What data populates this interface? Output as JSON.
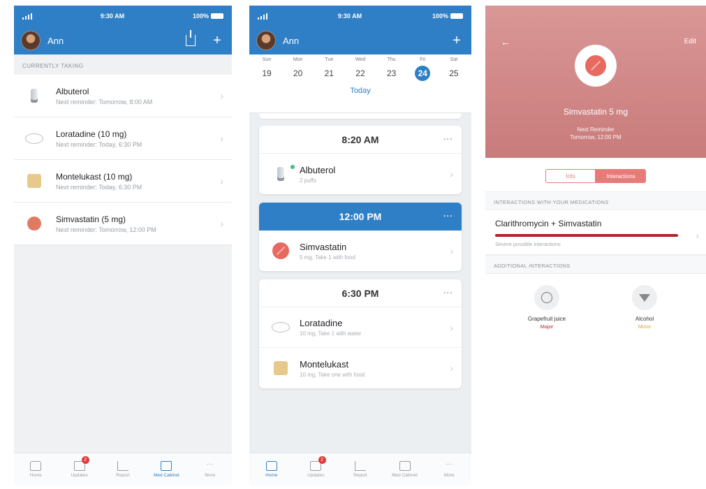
{
  "status": {
    "time": "9:30 AM",
    "battery": "100%"
  },
  "user": {
    "name": "Ann"
  },
  "screen1": {
    "section_label": "CURRENTLY TAKING",
    "medications": [
      {
        "name": "Albuterol",
        "reminder": "Next reminder: Tomorrow, 8:00 AM",
        "icon": "inhaler-icon"
      },
      {
        "name": "Loratadine (10 mg)",
        "reminder": "Next reminder: Today, 6:30 PM",
        "icon": "oval-pill-icon"
      },
      {
        "name": "Montelukast (10 mg)",
        "reminder": "Next reminder: Today, 6:30 PM",
        "icon": "square-pill-icon"
      },
      {
        "name": "Simvastatin (5 mg)",
        "reminder": "Next reminder: Tomorrow, 12:00 PM",
        "icon": "round-pill-icon"
      }
    ]
  },
  "tabbar": {
    "tabs": [
      {
        "label": "Home",
        "icon": "home-icon"
      },
      {
        "label": "Updates",
        "icon": "updates-icon",
        "badge": "2"
      },
      {
        "label": "Report",
        "icon": "report-icon"
      },
      {
        "label": "Med Cabinet",
        "icon": "med-cabinet-icon"
      },
      {
        "label": "More",
        "icon": "more-icon"
      }
    ],
    "screen1_active": "Med Cabinet",
    "screen2_active": "Home"
  },
  "screen2": {
    "week": [
      {
        "dow": "Sun",
        "day": "19"
      },
      {
        "dow": "Mon",
        "day": "20"
      },
      {
        "dow": "Tue",
        "day": "21"
      },
      {
        "dow": "Wed",
        "day": "22"
      },
      {
        "dow": "Thu",
        "day": "23"
      },
      {
        "dow": "Fri",
        "day": "24",
        "selected": true
      },
      {
        "dow": "Sat",
        "day": "25"
      }
    ],
    "today_label": "Today",
    "schedule": [
      {
        "time": "8:20 AM",
        "doses": [
          {
            "name": "Albuterol",
            "detail": "2 puffs"
          }
        ]
      },
      {
        "time": "12:00 PM",
        "highlight": true,
        "doses": [
          {
            "name": "Simvastatin",
            "detail": "5 mg, Take 1 with food"
          }
        ]
      },
      {
        "time": "6:30 PM",
        "doses": [
          {
            "name": "Loratadine",
            "detail": "10 mg, Take 1 with water"
          },
          {
            "name": "Montelukast",
            "detail": "10 mg, Take one with food"
          }
        ]
      }
    ]
  },
  "screen3": {
    "edit_label": "Edit",
    "drug_title": "Simvastatin 5 mg",
    "reminder_line1": "Next Reminder",
    "reminder_line2": "Tomorrow, 12:00 PM",
    "segments": {
      "info": "Info",
      "interactions": "Interactions"
    },
    "interactions_label": "INTERACTIONS WITH YOUR MEDICATIONS",
    "interaction": {
      "title": "Clarithromycin + Simvastatin",
      "desc": "Severe possible interactions"
    },
    "additional_label": "ADDITIONAL INTERACTIONS",
    "additional": [
      {
        "name": "Grapefruit juice",
        "severity": "Major",
        "color": "#c0262d"
      },
      {
        "name": "Alcohol",
        "severity": "Minor",
        "color": "#e8a13a"
      }
    ],
    "severity_color": "#b4222b"
  }
}
